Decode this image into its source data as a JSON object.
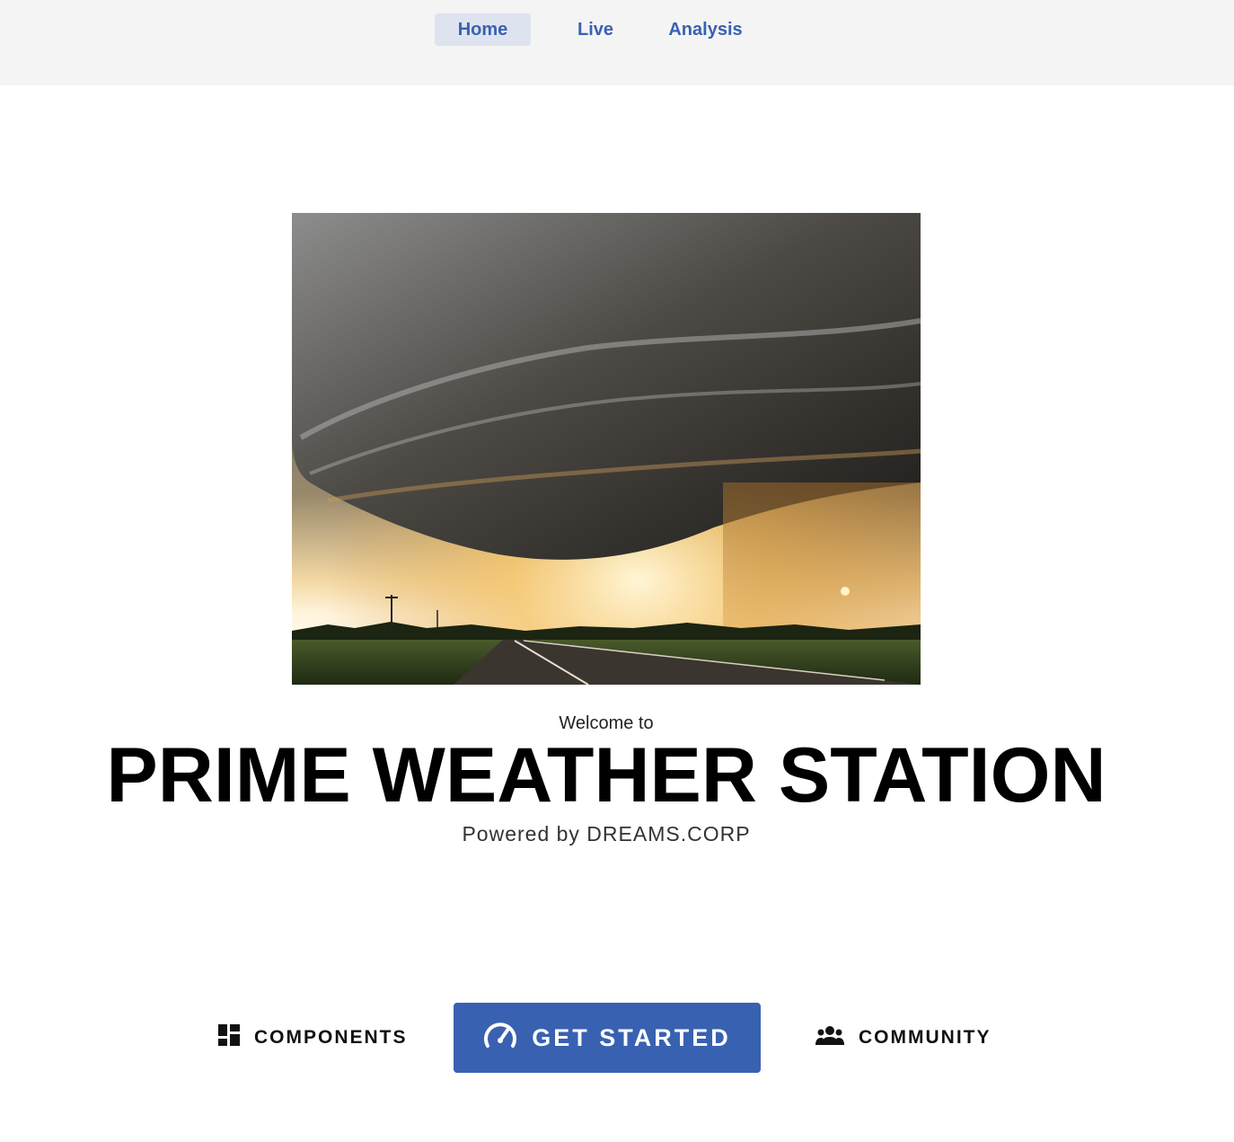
{
  "nav": {
    "items": [
      {
        "label": "Home",
        "active": true
      },
      {
        "label": "Live",
        "active": false
      },
      {
        "label": "Analysis",
        "active": false
      }
    ]
  },
  "hero": {
    "image_alt_icon": "storm-photo"
  },
  "heading": {
    "welcome": "Welcome to",
    "title": "PRIME WEATHER STATION",
    "subtitle": "Powered by DREAMS.CORP"
  },
  "actions": {
    "components_label": "COMPONENTS",
    "components_icon": "dashboard-icon",
    "get_started_label": "GET STARTED",
    "get_started_icon": "speedometer-icon",
    "community_label": "COMMUNITY",
    "community_icon": "people-icon"
  },
  "colors": {
    "accent": "#3961b1",
    "nav_active_bg": "#dde3ef",
    "topbar_bg": "#f4f4f4"
  }
}
